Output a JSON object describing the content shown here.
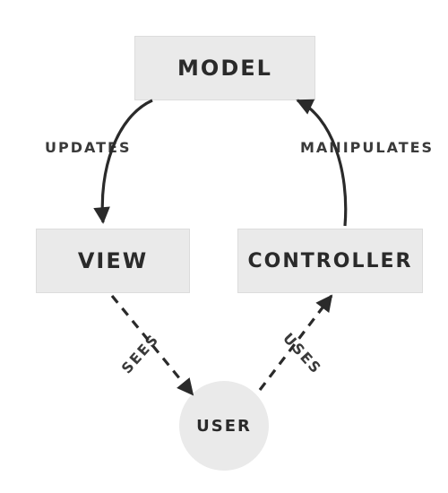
{
  "nodes": {
    "model": "MODEL",
    "view": "VIEW",
    "controller": "CONTROLLER",
    "user": "USER"
  },
  "edges": {
    "model_to_view": "UPDATES",
    "controller_to_model": "MANIPULATES",
    "view_to_user": "SEES",
    "user_to_controller": "USES"
  },
  "diagram": {
    "type": "mvc-cycle",
    "relations": [
      {
        "from": "model",
        "to": "view",
        "label": "UPDATES",
        "style": "solid"
      },
      {
        "from": "controller",
        "to": "model",
        "label": "MANIPULATES",
        "style": "solid"
      },
      {
        "from": "view",
        "to": "user",
        "label": "SEES",
        "style": "dashed"
      },
      {
        "from": "user",
        "to": "controller",
        "label": "USES",
        "style": "dashed"
      }
    ]
  }
}
